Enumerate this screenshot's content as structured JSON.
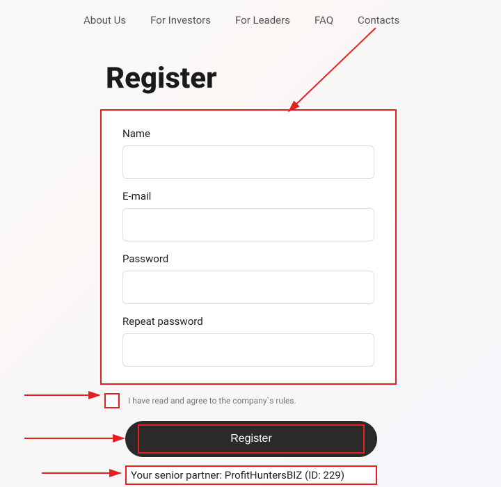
{
  "nav": {
    "items": [
      "About Us",
      "For Investors",
      "For Leaders",
      "FAQ",
      "Contacts"
    ]
  },
  "page": {
    "title": "Register"
  },
  "form": {
    "name_label": "Name",
    "email_label": "E-mail",
    "password_label": "Password",
    "repeat_password_label": "Repeat password"
  },
  "checkbox": {
    "label": "I have read and agree to the company`s rules."
  },
  "button": {
    "register": "Register"
  },
  "partner": {
    "text": "Your senior partner: ProfitHuntersBIZ (ID: 229)"
  }
}
